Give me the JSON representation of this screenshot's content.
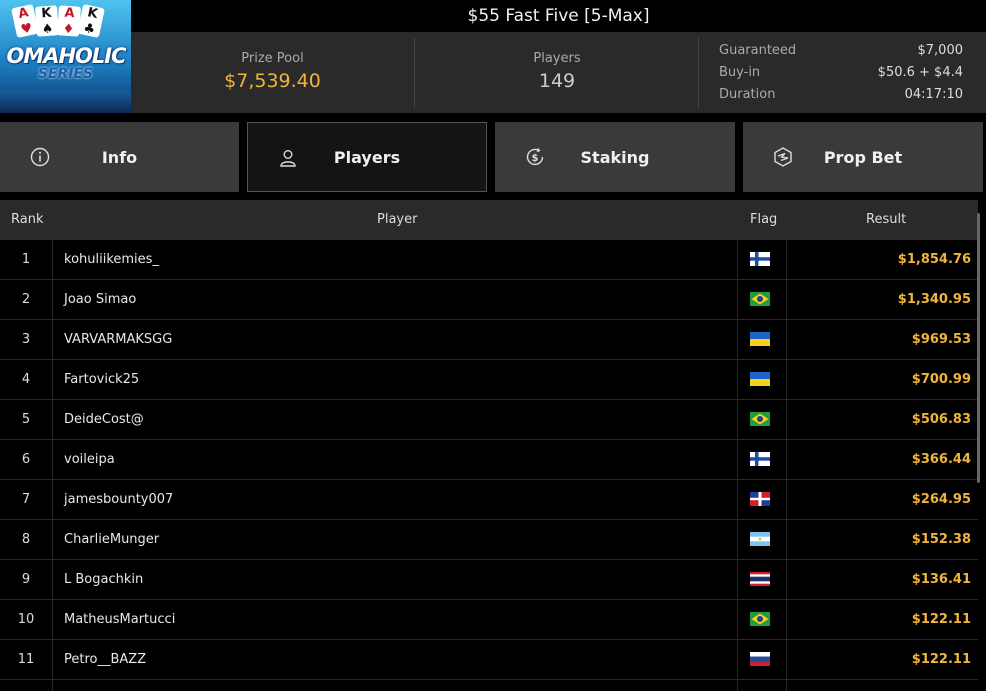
{
  "header": {
    "title": "$55 Fast Five [5-Max]",
    "logo": {
      "cards": [
        "A",
        "K",
        "A",
        "K"
      ],
      "wordmark": "OMAHOLIC",
      "subtitle": "SERIES"
    }
  },
  "stats": {
    "prize_pool_label": "Prize Pool",
    "prize_pool_value": "$7,539.40",
    "players_label": "Players",
    "players_value": "149",
    "details": [
      {
        "label": "Guaranteed",
        "value": "$7,000"
      },
      {
        "label": "Buy-in",
        "value": "$50.6 + $4.4"
      },
      {
        "label": "Duration",
        "value": "04:17:10"
      }
    ]
  },
  "tabs": [
    {
      "label": "Info",
      "icon": "info-circle-icon",
      "active": false
    },
    {
      "label": "Players",
      "icon": "user-icon",
      "active": true
    },
    {
      "label": "Staking",
      "icon": "dollar-circle-icon",
      "active": false
    },
    {
      "label": "Prop Bet",
      "icon": "hexagon-bolt-icon",
      "active": false
    }
  ],
  "table": {
    "columns": [
      "Rank",
      "Player",
      "Flag",
      "Result"
    ],
    "rows": [
      {
        "rank": "1",
        "player": "kohuliikemies_",
        "flag": "finland",
        "result": "$1,854.76"
      },
      {
        "rank": "2",
        "player": "Joao Simao",
        "flag": "brazil",
        "result": "$1,340.95"
      },
      {
        "rank": "3",
        "player": "VARVARMAKSGG",
        "flag": "ukraine",
        "result": "$969.53"
      },
      {
        "rank": "4",
        "player": "Fartovick25",
        "flag": "ukraine",
        "result": "$700.99"
      },
      {
        "rank": "5",
        "player": "DeideCost@",
        "flag": "brazil",
        "result": "$506.83"
      },
      {
        "rank": "6",
        "player": "voileipa",
        "flag": "finland",
        "result": "$366.44"
      },
      {
        "rank": "7",
        "player": "jamesbounty007",
        "flag": "dominican-republic",
        "result": "$264.95"
      },
      {
        "rank": "8",
        "player": "CharlieMunger",
        "flag": "argentina",
        "result": "$152.38"
      },
      {
        "rank": "9",
        "player": "L Bogachkin",
        "flag": "thailand",
        "result": "$136.41"
      },
      {
        "rank": "10",
        "player": "MatheusMartucci",
        "flag": "brazil",
        "result": "$122.11"
      },
      {
        "rank": "11",
        "player": "Petro__BAZZ",
        "flag": "russia",
        "result": "$122.11"
      }
    ]
  },
  "colors": {
    "accent": "#f0b43c",
    "background": "#000000",
    "panel": "#2a2a2a",
    "tab": "#3a3a3a"
  }
}
